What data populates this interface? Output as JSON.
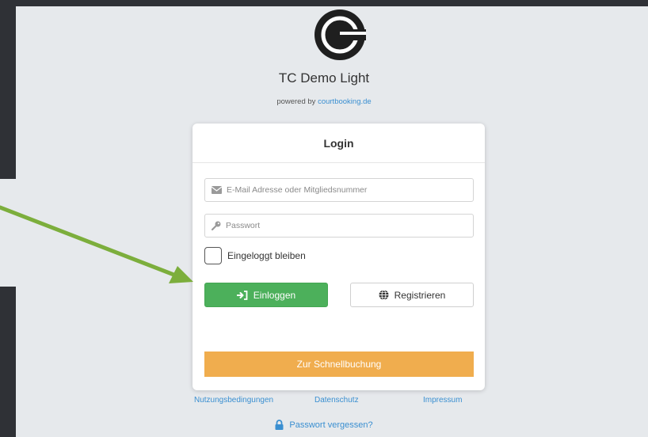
{
  "app": {
    "title": "TC Demo Light",
    "powered_prefix": "powered by",
    "powered_link": "courtbooking.de"
  },
  "login": {
    "header": "Login",
    "email_placeholder": "E-Mail Adresse oder Mitgliedsnummer",
    "password_placeholder": "Passwort",
    "remember_label": "Eingeloggt bleiben",
    "login_button": "Einloggen",
    "register_button": "Registrieren",
    "quick_booking_button": "Zur Schnellbuchung"
  },
  "footer": {
    "terms": "Nutzungsbedingungen",
    "privacy": "Datenschutz",
    "imprint": "Impressum",
    "forgot_password": "Passwort vergessen?"
  },
  "colors": {
    "login_green": "#4cb05b",
    "quick_orange": "#f0ad4e",
    "link_blue": "#3a8fd1",
    "annotation_arrow": "#7cae3c"
  },
  "icons": {
    "logo": "courtbooking-logo",
    "email": "envelope-icon",
    "password": "key-icon",
    "login": "sign-in-icon",
    "register": "globe-icon",
    "forgot": "lock-icon"
  }
}
